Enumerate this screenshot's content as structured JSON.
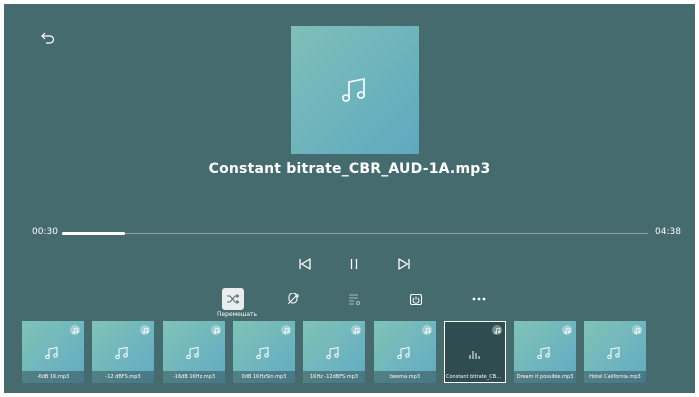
{
  "player": {
    "track_title": "Constant bitrate_CBR_AUD-1A.mp3",
    "elapsed": "00:30",
    "duration": "04:38",
    "progress_fraction": 0.108
  },
  "options": {
    "shuffle_tooltip": "Перемешать"
  },
  "playlist": [
    {
      "title": "-6dB 1K.mp3"
    },
    {
      "title": "-12 dBFS.mp3"
    },
    {
      "title": "-16dB 1KHz.mp3"
    },
    {
      "title": "0dB 1KHzSin.mp3"
    },
    {
      "title": "1KHz -12dBFS.mp3"
    },
    {
      "title": "beema.mp3"
    },
    {
      "title": "Constant bitrate_CBR...",
      "current": true
    },
    {
      "title": "Dream it possible.mp3"
    },
    {
      "title": "Hotel California.mp3"
    }
  ],
  "colors": {
    "background": "#466b6e",
    "accent": "#ffffff"
  }
}
